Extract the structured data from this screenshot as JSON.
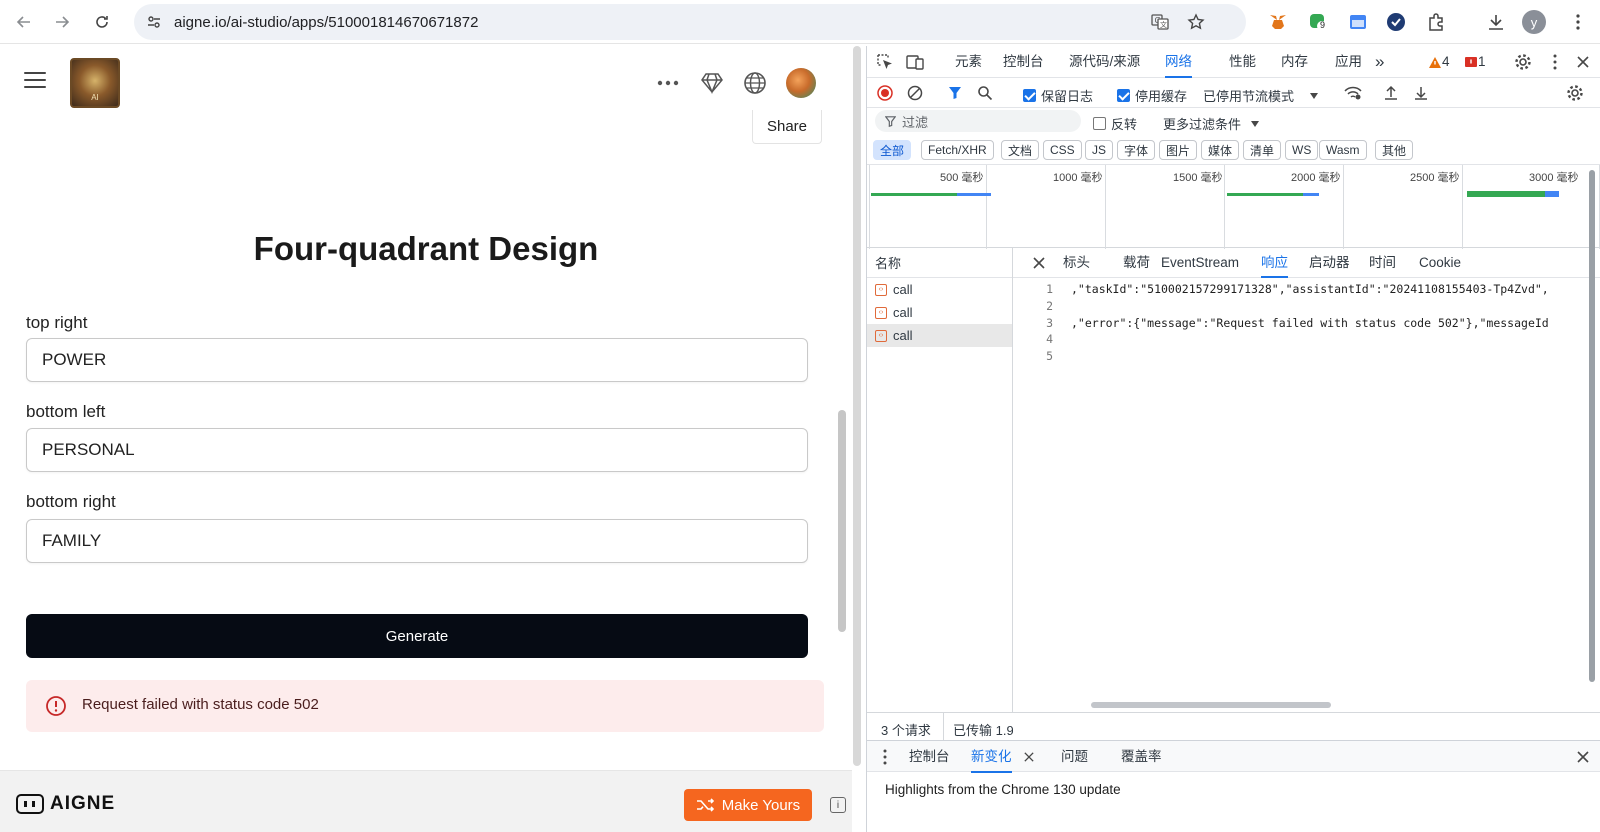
{
  "browser": {
    "url": "aigne.io/ai-studio/apps/510001814670671872",
    "profile_initial": "y",
    "extension_badge": "9"
  },
  "app": {
    "share_label": "Share",
    "title": "Four-quadrant Design",
    "fields": [
      {
        "label": "top right",
        "value": "POWER"
      },
      {
        "label": "bottom left",
        "value": "PERSONAL"
      },
      {
        "label": "bottom right",
        "value": "FAMILY"
      }
    ],
    "logo_text": "AI",
    "generate_label": "Generate",
    "error_message": "Request failed with status code 502",
    "brand_name": "AIGNE",
    "make_yours_label": "Make Yours",
    "info_label": "i"
  },
  "devtools": {
    "tabs": [
      "元素",
      "控制台",
      "源代码/来源",
      "网络",
      "性能",
      "内存",
      "应用"
    ],
    "more_tabs": "»",
    "active_tab": "网络",
    "warnings_count": "4",
    "errors_count": "1",
    "toolbar": {
      "preserve_log": "保留日志",
      "disable_cache": "停用缓存",
      "throttle": "已停用节流模式"
    },
    "filter": {
      "placeholder": "过滤",
      "invert": "反转",
      "more_filters": "更多过滤条件"
    },
    "type_chips": [
      "全部",
      "Fetch/XHR",
      "文档",
      "CSS",
      "JS",
      "字体",
      "图片",
      "媒体",
      "清单",
      "WS",
      "Wasm",
      "其他"
    ],
    "timeline_labels": [
      "500 毫秒",
      "1000 毫秒",
      "1500 毫秒",
      "2000 毫秒",
      "2500 毫秒",
      "3000 毫秒"
    ],
    "requests_header": "名称",
    "requests": [
      "call",
      "call",
      "call"
    ],
    "detail_tabs": [
      "标头",
      "载荷",
      "EventStream",
      "响应",
      "启动器",
      "时间",
      "Cookie"
    ],
    "code_lines": [
      {
        "n": "1",
        "text": ",\"taskId\":\"510002157299171328\",\"assistantId\":\"20241108155403-Tp4Zvd\","
      },
      {
        "n": "2",
        "text": ""
      },
      {
        "n": "3",
        "text": ",\"error\":{\"message\":\"Request failed with status code 502\"},\"messageId"
      },
      {
        "n": "4",
        "text": ""
      },
      {
        "n": "5",
        "text": ""
      }
    ],
    "status": {
      "requests": "3 个请求",
      "transferred": "已传输 1.9"
    },
    "drawer_tabs": [
      "控制台",
      "新变化",
      "问题",
      "覆盖率"
    ],
    "drawer_message": "Highlights from the Chrome 130 update"
  }
}
